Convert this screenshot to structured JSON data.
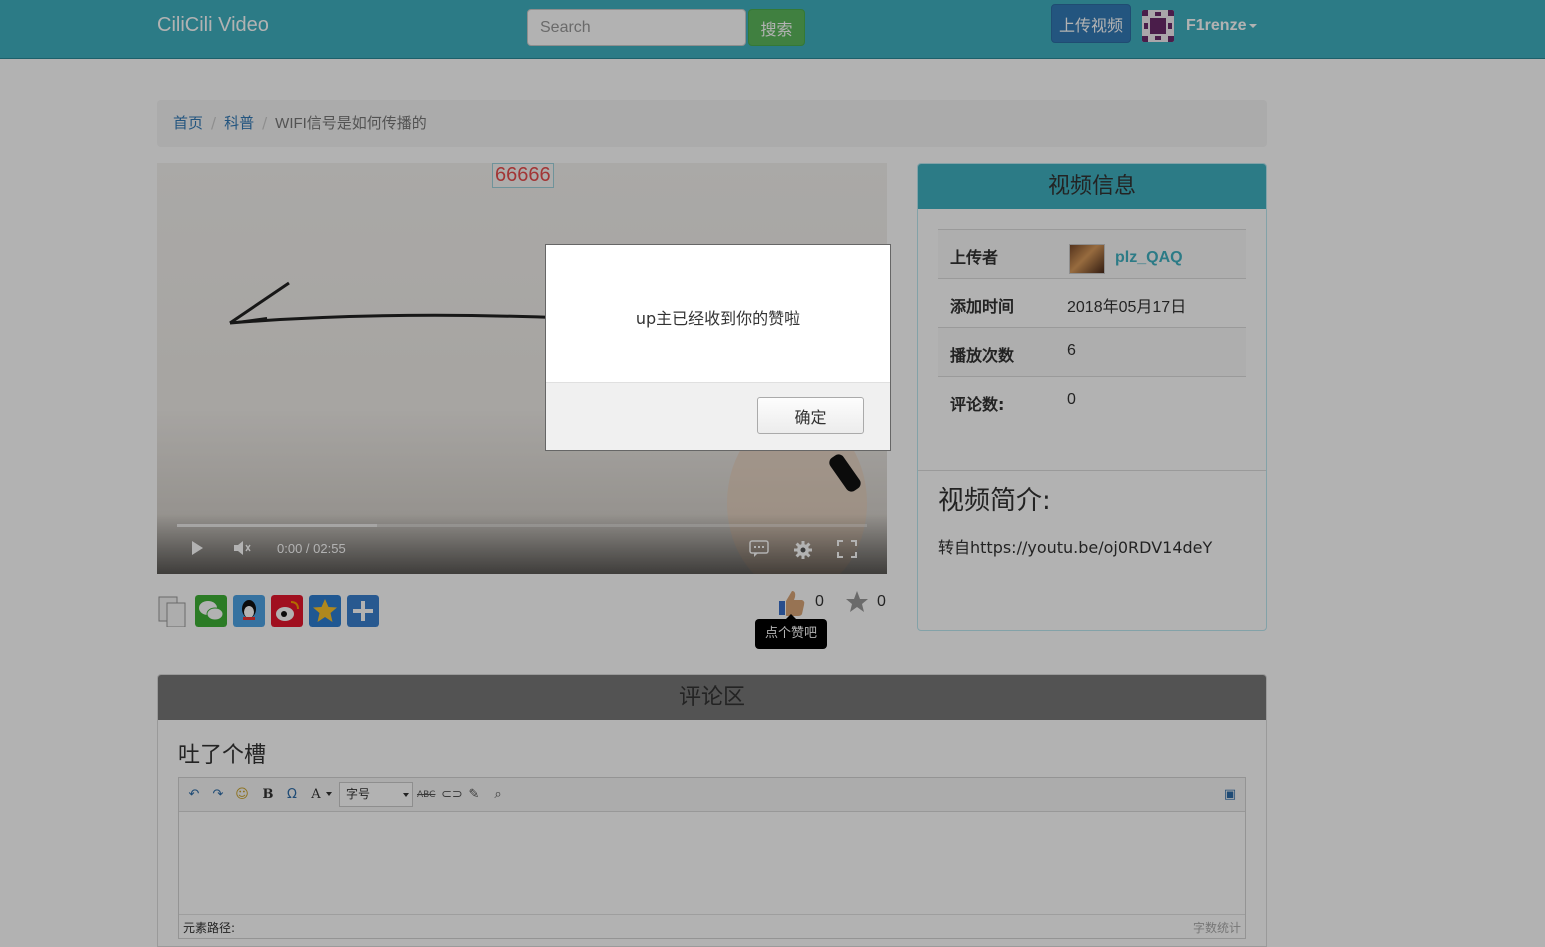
{
  "navbar": {
    "brand": "CiliCili Video",
    "search_placeholder": "Search",
    "search_button": "搜索",
    "upload_button": "上传视频",
    "username": "F1renze"
  },
  "breadcrumb": {
    "items": [
      "首页",
      "科普"
    ],
    "current": "WIFI信号是如何传播的"
  },
  "video": {
    "danmaku": "66666",
    "time": "0:00 / 02:55",
    "buffered_fraction": 0.29
  },
  "actions": {
    "like_count": "0",
    "favorite_count": "0",
    "like_tooltip": "点个赞吧",
    "share_icons": [
      "copy-icon",
      "wechat-icon",
      "qq-icon",
      "weibo-icon",
      "qzone-icon",
      "more-icon"
    ]
  },
  "info_panel": {
    "heading": "视频信息",
    "rows": [
      {
        "key": "上传者",
        "value": "plz_QAQ"
      },
      {
        "key": "添加时间",
        "value": "2018年05月17日"
      },
      {
        "key": "播放次数",
        "value": "6"
      },
      {
        "key": "评论数:",
        "value": "0"
      }
    ],
    "desc_title": "视频简介:",
    "desc_text": "转自https://youtu.be/oj0RDV14deY"
  },
  "comments": {
    "heading": "评论区",
    "subheading": "吐了个槽",
    "font_size_label": "字号",
    "element_path_label": "元素路径:",
    "word_count_label": "字数统计"
  },
  "dialog": {
    "message": "up主已经收到你的赞啦",
    "ok_button": "确定"
  },
  "colors": {
    "navbar": "#3fb0c0",
    "primary": "#337ab7",
    "success": "#5cb85c"
  }
}
